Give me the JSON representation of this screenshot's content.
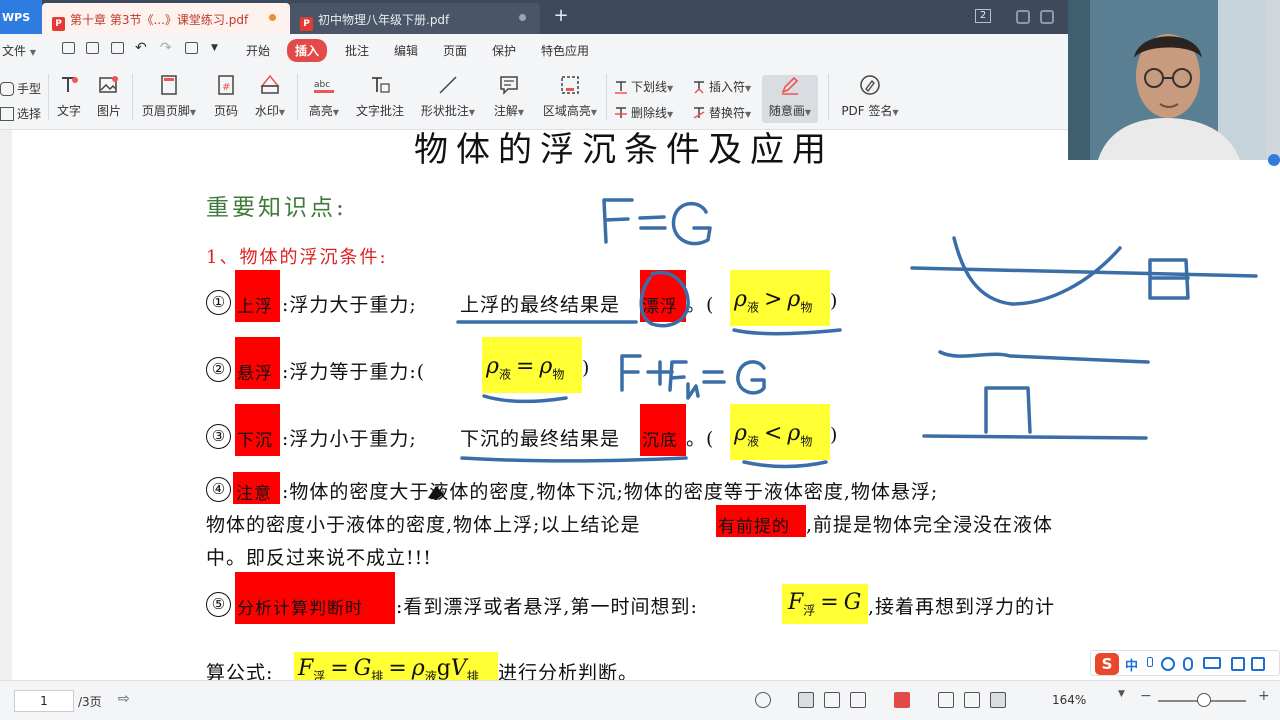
{
  "tabs": {
    "app_label": "WPS",
    "active": "第十章 第3节《...》课堂练习.pdf",
    "inactive": "初中物理八年级下册.pdf",
    "window_count": "2"
  },
  "menu": {
    "file": "文件",
    "items": [
      "开始",
      "插入",
      "批注",
      "编辑",
      "页面",
      "保护",
      "特色应用"
    ],
    "active_index": 1
  },
  "ribbon": {
    "hand": "手型",
    "select": "选择",
    "text": "文字",
    "image": "图片",
    "header_footer": "页眉页脚",
    "page_number": "页码",
    "watermark": "水印",
    "highlight": "高亮",
    "text_comment": "文字批注",
    "shape_comment": "形状批注",
    "note": "注解",
    "area_highlight": "区域高亮",
    "underline": "下划线",
    "strikethrough": "删除线",
    "insert_mark": "插入符",
    "replace_mark": "替换符",
    "freehand": "随意画",
    "pdf_sign": "PDF 签名"
  },
  "doc": {
    "title": "物体的浮沉条件及应用",
    "section_heading": "重要知识点:",
    "sub_heading": "1、物体的浮沉条件:",
    "item1": {
      "num": "①",
      "tag": "上浮",
      "text_a": ":浮力大于重力;",
      "text_b": "上浮的最终结果是",
      "tag2": "漂浮",
      "text_c": "。(",
      "close": ")"
    },
    "item2": {
      "num": "②",
      "tag": "悬浮",
      "text_a": ":浮力等于重力:(",
      "close": ")"
    },
    "item3": {
      "num": "③",
      "tag": "下沉",
      "text_a": ":浮力小于重力;",
      "text_b": "下沉的最终结果是",
      "tag2": "沉底",
      "text_c": "。(",
      "close": ")"
    },
    "item4": {
      "num": "④",
      "tag": "注意",
      "line1": ":物体的密度大于液体的密度,物体下沉;物体的密度等于液体密度,物体悬浮;",
      "line2a": "物体的密度小于液体的密度,物体上浮;以上结论是",
      "tag2": "有前提的",
      "line2b": ",前提是物体完全浸没在液体",
      "line3": "中。即反过来说不成立!!!"
    },
    "item5": {
      "num": "⑤",
      "tag": "分析计算判断时",
      "text_a": ":看到漂浮或者悬浮,第一时间想到:",
      "text_b": ",接着再想到浮力的计"
    },
    "last": {
      "prefix": "算公式:",
      "suffix": "进行分析判断。"
    },
    "formulas": {
      "rho": "ρ",
      "liquid": "液",
      "object": "物",
      "gt": ">",
      "eq": "=",
      "lt": "<",
      "F": "F",
      "float": "浮",
      "G": "G",
      "displaced": "排",
      "g": "g",
      "V": "V"
    }
  },
  "ime": {
    "logo": "S",
    "mode": "中"
  },
  "status": {
    "page": "1",
    "total": "/3页",
    "zoom": "164%"
  }
}
